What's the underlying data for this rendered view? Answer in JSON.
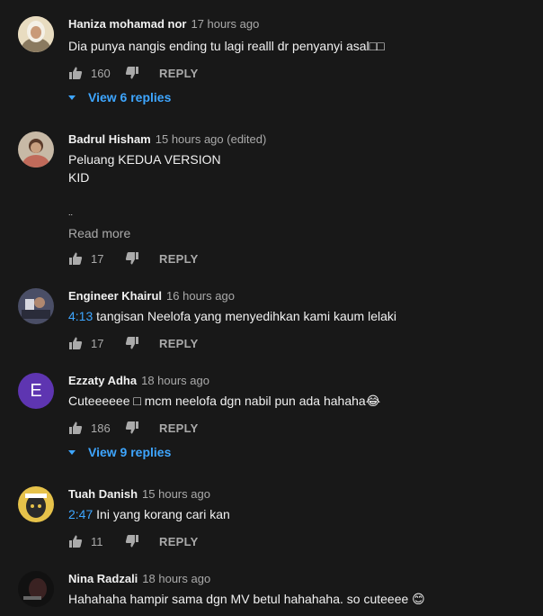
{
  "colors": {
    "background": "#181818",
    "text": "#f1f1f1",
    "secondary": "#aaaaaa",
    "link": "#3ea6ff",
    "avatar_e": "#5e35b1"
  },
  "comments": [
    {
      "author": "Haniza mohamad nor",
      "time": "17 hours ago",
      "text": "Dia punya nangis ending tu lagi realll dr penyanyi asal□□",
      "likes": "160",
      "reply_label": "REPLY",
      "view_replies": "View 6 replies"
    },
    {
      "author": "Badrul Hisham",
      "time": "15 hours ago (edited)",
      "lines": [
        "Peluang KEDUA VERSION",
        "KID",
        "",
        ".."
      ],
      "read_more": "Read more",
      "likes": "17",
      "reply_label": "REPLY"
    },
    {
      "author": "Engineer Khairul",
      "time": "16 hours ago",
      "timestamp": "4:13",
      "text": " tangisan Neelofa yang menyedihkan kami kaum lelaki",
      "likes": "17",
      "reply_label": "REPLY"
    },
    {
      "author": "Ezzaty Adha",
      "time": "18 hours ago",
      "avatar_letter": "E",
      "text": "Cuteeeeee □ mcm neelofa dgn nabil pun ada hahaha😂",
      "likes": "186",
      "reply_label": "REPLY",
      "view_replies": "View 9 replies"
    },
    {
      "author": "Tuah Danish",
      "time": "15 hours ago",
      "timestamp": "2:47",
      "text": " Ini yang korang cari kan",
      "likes": "11",
      "reply_label": "REPLY"
    },
    {
      "author": "Nina Radzali",
      "time": "18 hours ago",
      "text": "Hahahaha hampir sama dgn MV betul hahahaha. so cuteeee 😊"
    }
  ]
}
